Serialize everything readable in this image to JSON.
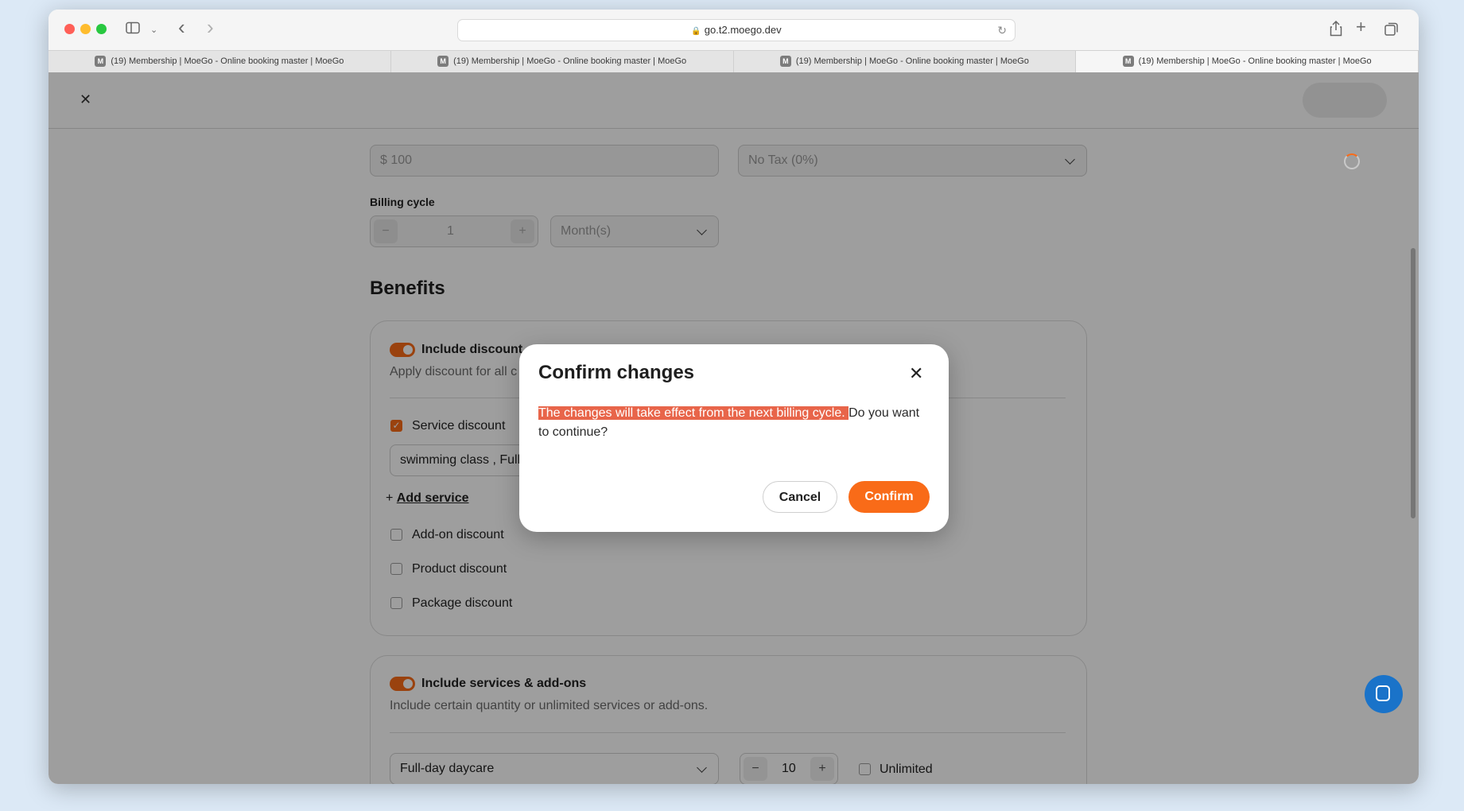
{
  "browser": {
    "url": "go.t2.moego.dev",
    "tabs": [
      "(19) Membership | MoeGo - Online booking master | MoeGo",
      "(19) Membership | MoeGo - Online booking master | MoeGo",
      "(19) Membership | MoeGo - Online booking master | MoeGo",
      "(19) Membership | MoeGo - Online booking master | MoeGo"
    ],
    "active_tab": 3,
    "favicon_letter": "M"
  },
  "form": {
    "price_value": "$  100",
    "tax_value": "No Tax (0%)",
    "billing_cycle_label": "Billing cycle",
    "billing_cycle_count": "1",
    "billing_cycle_unit": "Month(s)",
    "stepper_minus": "−",
    "stepper_plus": "+",
    "benefits_title": "Benefits"
  },
  "discount_card": {
    "toggle_label": "Include discount",
    "description": "Apply discount for all c",
    "service_discount": {
      "label": "Service discount",
      "checked": true
    },
    "service_chip": "swimming class , Full",
    "add_service": "Add service",
    "add_service_plus": "+",
    "addon_discount": {
      "label": "Add-on discount",
      "checked": false
    },
    "product_discount": {
      "label": "Product discount",
      "checked": false
    },
    "package_discount": {
      "label": "Package discount",
      "checked": false
    }
  },
  "services_card": {
    "toggle_label": "Include services & add-ons",
    "description": "Include certain quantity or unlimited services or add-ons.",
    "service_select": "Full-day daycare",
    "quantity": "10",
    "unlimited_label": "Unlimited"
  },
  "modal": {
    "title": "Confirm changes",
    "close_glyph": "✕",
    "highlighted_text": "The changes will take effect from the next billing cycle. ",
    "body_rest": "Do you want to continue?",
    "cancel_label": "Cancel",
    "confirm_label": "Confirm"
  },
  "colors": {
    "accent": "#f96b18",
    "highlight": "#e8654a",
    "chat_bubble": "#1a73c9"
  },
  "icons": {
    "close_page": "✕",
    "back": "‹",
    "forward": "›"
  }
}
